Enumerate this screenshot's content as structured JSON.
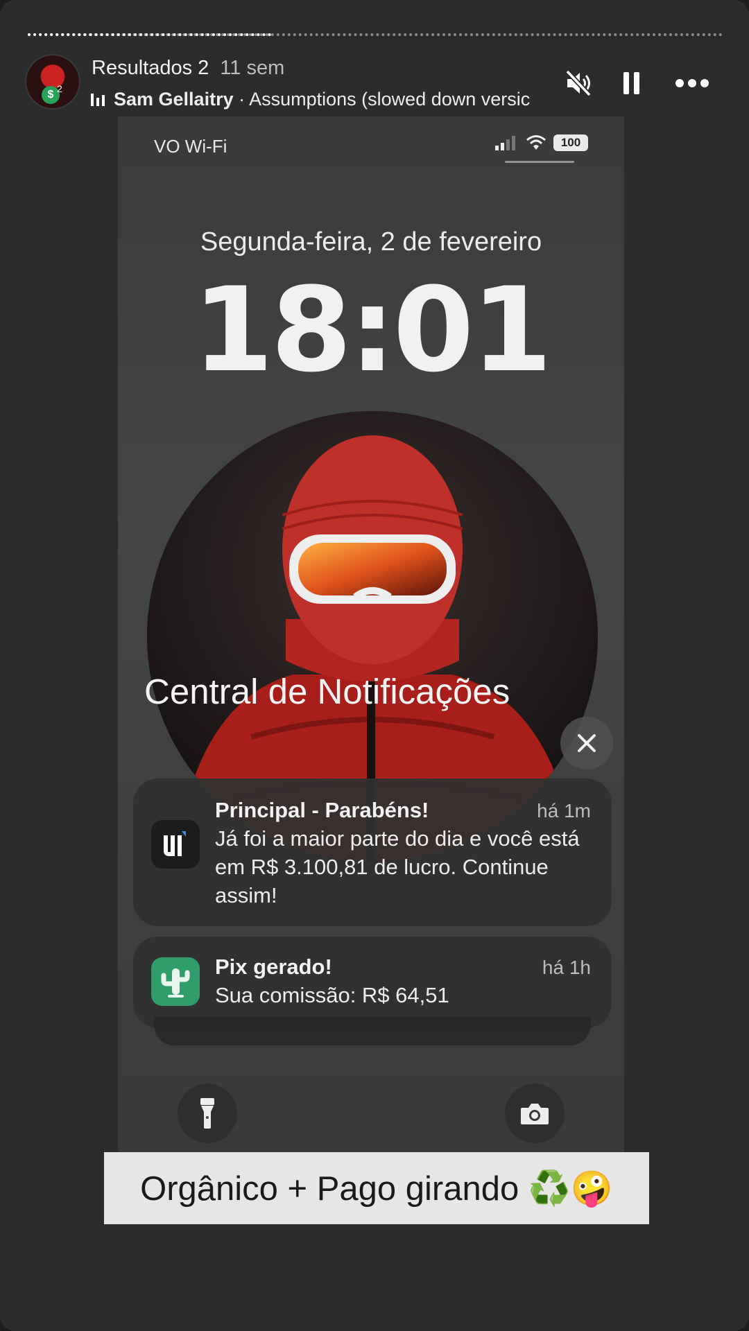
{
  "story": {
    "progress": 0.35,
    "account_name": "Resultados 2",
    "posted_ago": "11 sem",
    "avatar_badge": "$",
    "avatar_badge_count": "2",
    "music_artist": "Sam Gellaitry",
    "music_separator": " · ",
    "music_track": "Assumptions (slowed down versic",
    "icons": {
      "mute": "speaker-muted-icon",
      "pause": "pause-icon",
      "more": "more-dots-icon",
      "music": "music-bars-icon"
    }
  },
  "lockscreen": {
    "carrier": "VO Wi-Fi",
    "battery": "100",
    "date": "Segunda-feira, 2 de fevereiro",
    "time": "18:01",
    "notification_center_title": "Central de Notificações",
    "notifications": [
      {
        "app_icon": "app-logo-icon",
        "title": "Principal - Parabéns!",
        "ago": "há 1m",
        "body": "Já foi a maior parte do dia e você está em R$ 3.100,81 de lucro. Continue assim!"
      },
      {
        "app_icon": "cactus-icon",
        "title": "Pix gerado!",
        "ago": "há 1h",
        "body": "Sua comissão: R$ 64,51"
      }
    ],
    "quick_actions": [
      "flashlight-icon",
      "camera-icon"
    ]
  },
  "caption": "Orgânico + Pago girando ♻️🤪",
  "colors": {
    "background": "#2c2c2d",
    "caption_bg": "#e6e6e6",
    "accent_red": "#c7302b",
    "pix_green": "#2f9e6b"
  }
}
